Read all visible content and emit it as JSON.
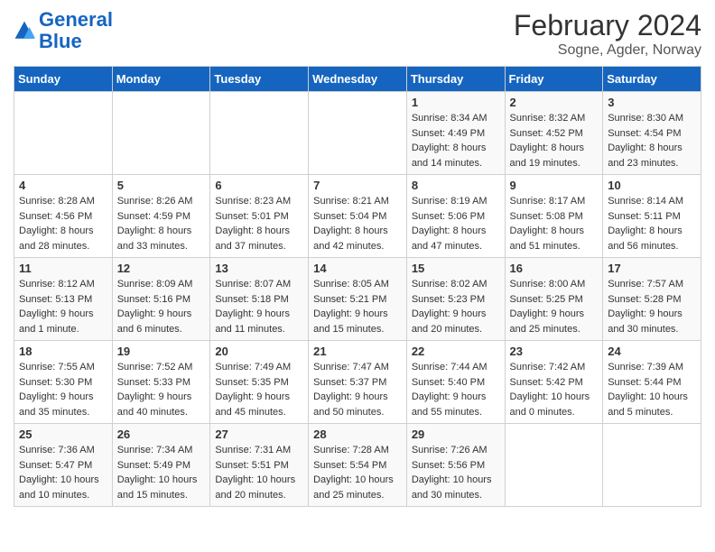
{
  "header": {
    "logo_line1": "General",
    "logo_line2": "Blue",
    "title": "February 2024",
    "subtitle": "Sogne, Agder, Norway"
  },
  "weekdays": [
    "Sunday",
    "Monday",
    "Tuesday",
    "Wednesday",
    "Thursday",
    "Friday",
    "Saturday"
  ],
  "weeks": [
    [
      {
        "day": "",
        "sunrise": "",
        "sunset": "",
        "daylight": ""
      },
      {
        "day": "",
        "sunrise": "",
        "sunset": "",
        "daylight": ""
      },
      {
        "day": "",
        "sunrise": "",
        "sunset": "",
        "daylight": ""
      },
      {
        "day": "",
        "sunrise": "",
        "sunset": "",
        "daylight": ""
      },
      {
        "day": "1",
        "sunrise": "Sunrise: 8:34 AM",
        "sunset": "Sunset: 4:49 PM",
        "daylight": "Daylight: 8 hours and 14 minutes."
      },
      {
        "day": "2",
        "sunrise": "Sunrise: 8:32 AM",
        "sunset": "Sunset: 4:52 PM",
        "daylight": "Daylight: 8 hours and 19 minutes."
      },
      {
        "day": "3",
        "sunrise": "Sunrise: 8:30 AM",
        "sunset": "Sunset: 4:54 PM",
        "daylight": "Daylight: 8 hours and 23 minutes."
      }
    ],
    [
      {
        "day": "4",
        "sunrise": "Sunrise: 8:28 AM",
        "sunset": "Sunset: 4:56 PM",
        "daylight": "Daylight: 8 hours and 28 minutes."
      },
      {
        "day": "5",
        "sunrise": "Sunrise: 8:26 AM",
        "sunset": "Sunset: 4:59 PM",
        "daylight": "Daylight: 8 hours and 33 minutes."
      },
      {
        "day": "6",
        "sunrise": "Sunrise: 8:23 AM",
        "sunset": "Sunset: 5:01 PM",
        "daylight": "Daylight: 8 hours and 37 minutes."
      },
      {
        "day": "7",
        "sunrise": "Sunrise: 8:21 AM",
        "sunset": "Sunset: 5:04 PM",
        "daylight": "Daylight: 8 hours and 42 minutes."
      },
      {
        "day": "8",
        "sunrise": "Sunrise: 8:19 AM",
        "sunset": "Sunset: 5:06 PM",
        "daylight": "Daylight: 8 hours and 47 minutes."
      },
      {
        "day": "9",
        "sunrise": "Sunrise: 8:17 AM",
        "sunset": "Sunset: 5:08 PM",
        "daylight": "Daylight: 8 hours and 51 minutes."
      },
      {
        "day": "10",
        "sunrise": "Sunrise: 8:14 AM",
        "sunset": "Sunset: 5:11 PM",
        "daylight": "Daylight: 8 hours and 56 minutes."
      }
    ],
    [
      {
        "day": "11",
        "sunrise": "Sunrise: 8:12 AM",
        "sunset": "Sunset: 5:13 PM",
        "daylight": "Daylight: 9 hours and 1 minute."
      },
      {
        "day": "12",
        "sunrise": "Sunrise: 8:09 AM",
        "sunset": "Sunset: 5:16 PM",
        "daylight": "Daylight: 9 hours and 6 minutes."
      },
      {
        "day": "13",
        "sunrise": "Sunrise: 8:07 AM",
        "sunset": "Sunset: 5:18 PM",
        "daylight": "Daylight: 9 hours and 11 minutes."
      },
      {
        "day": "14",
        "sunrise": "Sunrise: 8:05 AM",
        "sunset": "Sunset: 5:21 PM",
        "daylight": "Daylight: 9 hours and 15 minutes."
      },
      {
        "day": "15",
        "sunrise": "Sunrise: 8:02 AM",
        "sunset": "Sunset: 5:23 PM",
        "daylight": "Daylight: 9 hours and 20 minutes."
      },
      {
        "day": "16",
        "sunrise": "Sunrise: 8:00 AM",
        "sunset": "Sunset: 5:25 PM",
        "daylight": "Daylight: 9 hours and 25 minutes."
      },
      {
        "day": "17",
        "sunrise": "Sunrise: 7:57 AM",
        "sunset": "Sunset: 5:28 PM",
        "daylight": "Daylight: 9 hours and 30 minutes."
      }
    ],
    [
      {
        "day": "18",
        "sunrise": "Sunrise: 7:55 AM",
        "sunset": "Sunset: 5:30 PM",
        "daylight": "Daylight: 9 hours and 35 minutes."
      },
      {
        "day": "19",
        "sunrise": "Sunrise: 7:52 AM",
        "sunset": "Sunset: 5:33 PM",
        "daylight": "Daylight: 9 hours and 40 minutes."
      },
      {
        "day": "20",
        "sunrise": "Sunrise: 7:49 AM",
        "sunset": "Sunset: 5:35 PM",
        "daylight": "Daylight: 9 hours and 45 minutes."
      },
      {
        "day": "21",
        "sunrise": "Sunrise: 7:47 AM",
        "sunset": "Sunset: 5:37 PM",
        "daylight": "Daylight: 9 hours and 50 minutes."
      },
      {
        "day": "22",
        "sunrise": "Sunrise: 7:44 AM",
        "sunset": "Sunset: 5:40 PM",
        "daylight": "Daylight: 9 hours and 55 minutes."
      },
      {
        "day": "23",
        "sunrise": "Sunrise: 7:42 AM",
        "sunset": "Sunset: 5:42 PM",
        "daylight": "Daylight: 10 hours and 0 minutes."
      },
      {
        "day": "24",
        "sunrise": "Sunrise: 7:39 AM",
        "sunset": "Sunset: 5:44 PM",
        "daylight": "Daylight: 10 hours and 5 minutes."
      }
    ],
    [
      {
        "day": "25",
        "sunrise": "Sunrise: 7:36 AM",
        "sunset": "Sunset: 5:47 PM",
        "daylight": "Daylight: 10 hours and 10 minutes."
      },
      {
        "day": "26",
        "sunrise": "Sunrise: 7:34 AM",
        "sunset": "Sunset: 5:49 PM",
        "daylight": "Daylight: 10 hours and 15 minutes."
      },
      {
        "day": "27",
        "sunrise": "Sunrise: 7:31 AM",
        "sunset": "Sunset: 5:51 PM",
        "daylight": "Daylight: 10 hours and 20 minutes."
      },
      {
        "day": "28",
        "sunrise": "Sunrise: 7:28 AM",
        "sunset": "Sunset: 5:54 PM",
        "daylight": "Daylight: 10 hours and 25 minutes."
      },
      {
        "day": "29",
        "sunrise": "Sunrise: 7:26 AM",
        "sunset": "Sunset: 5:56 PM",
        "daylight": "Daylight: 10 hours and 30 minutes."
      },
      {
        "day": "",
        "sunrise": "",
        "sunset": "",
        "daylight": ""
      },
      {
        "day": "",
        "sunrise": "",
        "sunset": "",
        "daylight": ""
      }
    ]
  ]
}
